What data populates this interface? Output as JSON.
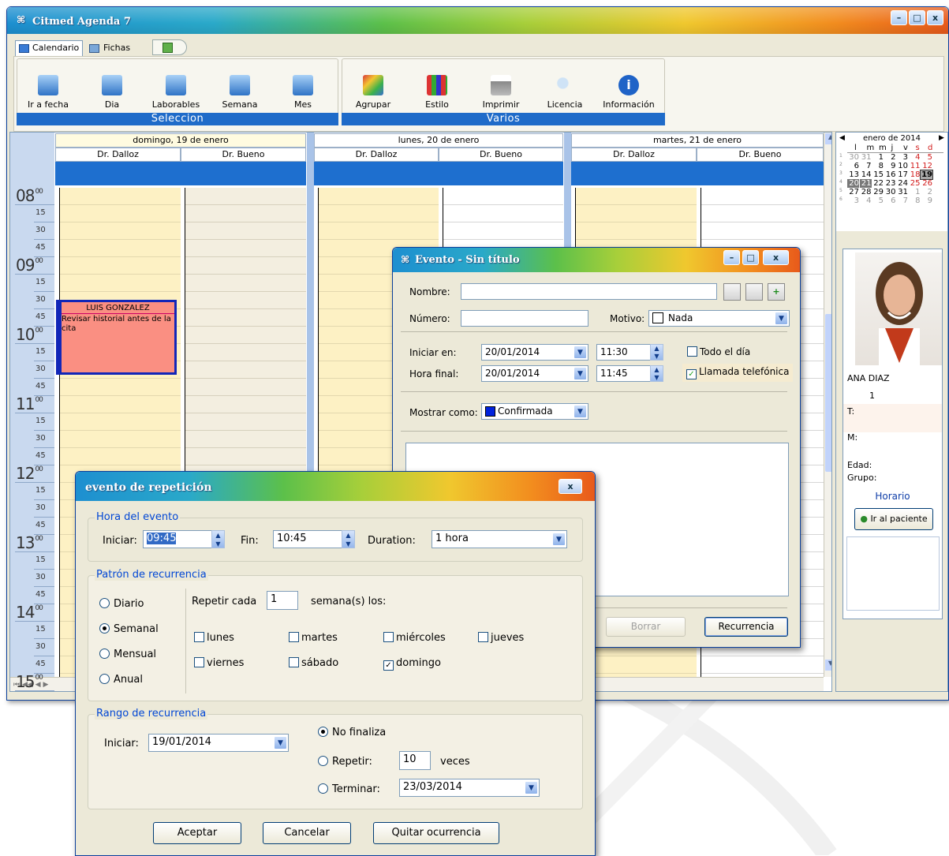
{
  "app": {
    "title": "Citmed Agenda 7"
  },
  "tabs": [
    {
      "label": "Calendario"
    },
    {
      "label": "Fichas"
    }
  ],
  "toolbar": {
    "seleccion": {
      "label": "Seleccion",
      "buttons": [
        "Ir a fecha",
        "Dia",
        "Laborables",
        "Semana",
        "Mes"
      ]
    },
    "varios": {
      "label": "Varios",
      "buttons": [
        "Agrupar",
        "Estilo",
        "Imprimir",
        "Licencia",
        "Información"
      ]
    }
  },
  "calendar": {
    "days": [
      "domingo, 19 de enero",
      "lunes, 20 de enero",
      "martes, 21 de enero"
    ],
    "doctors": [
      "Dr. Dalloz",
      "Dr. Bueno"
    ],
    "hours": [
      "08",
      "09",
      "10",
      "11",
      "12",
      "13",
      "14",
      "15"
    ],
    "minute_marks": [
      "00",
      "15",
      "30",
      "45"
    ],
    "event": {
      "title": "LUIS GONZALEZ",
      "text": "Revisar historial antes de la cita"
    }
  },
  "mini_calendar": {
    "month": "enero de 2014",
    "weekdays": [
      "l",
      "m",
      "m",
      "j",
      "v",
      "s",
      "d"
    ],
    "weeks": [
      {
        "wk": "1",
        "days": [
          "30",
          "31",
          "1",
          "2",
          "3",
          "4",
          "5"
        ]
      },
      {
        "wk": "2",
        "days": [
          "6",
          "7",
          "8",
          "9",
          "10",
          "11",
          "12"
        ]
      },
      {
        "wk": "3",
        "days": [
          "13",
          "14",
          "15",
          "16",
          "17",
          "18",
          "19"
        ]
      },
      {
        "wk": "4",
        "days": [
          "20",
          "21",
          "22",
          "23",
          "24",
          "25",
          "26"
        ]
      },
      {
        "wk": "5",
        "days": [
          "27",
          "28",
          "29",
          "30",
          "31",
          "1",
          "2"
        ]
      },
      {
        "wk": "6",
        "days": [
          "3",
          "4",
          "5",
          "6",
          "7",
          "8",
          "9"
        ]
      }
    ]
  },
  "patient": {
    "name": "ANA DIAZ",
    "id": "1",
    "t_label": "T:",
    "m_label": "M:",
    "edad_label": "Edad:",
    "grupo_label": "Grupo:",
    "horario_label": "Horario",
    "go_button": "Ir al paciente"
  },
  "evento": {
    "title": "Evento - Sin título",
    "nombre_label": "Nombre:",
    "numero_label": "Número:",
    "motivo_label": "Motivo:",
    "motivo_value": "Nada",
    "iniciar_label": "Iniciar en:",
    "iniciar_date": "20/01/2014",
    "iniciar_time": "11:30",
    "final_label": "Hora final:",
    "final_date": "20/01/2014",
    "final_time": "11:45",
    "todo_dia": "Todo el día",
    "llamada": "Llamada telefónica",
    "mostrar_label": "Mostrar como:",
    "mostrar_value": "Confirmada",
    "borrar": "Borrar",
    "recurrencia": "Recurrencia"
  },
  "repeticion": {
    "title": "evento de repetición",
    "hora_group": "Hora del evento",
    "iniciar_label": "Iniciar:",
    "iniciar_value": "09:45",
    "fin_label": "Fin:",
    "fin_value": "10:45",
    "duration_label": "Duration:",
    "duration_value": "1 hora",
    "patron_group": "Patrón de recurrencia",
    "options": [
      "Diario",
      "Semanal",
      "Mensual",
      "Anual"
    ],
    "repetir_label": "Repetir cada",
    "repetir_value": "1",
    "semanas_label": "semana(s) los:",
    "days": [
      "lunes",
      "martes",
      "miércoles",
      "jueves",
      "viernes",
      "sábado",
      "domingo"
    ],
    "rango_group": "Rango de recurrencia",
    "rango_iniciar_label": "Iniciar:",
    "rango_iniciar_value": "19/01/2014",
    "no_finaliza": "No finaliza",
    "repetir": "Repetir:",
    "repetir_count": "10",
    "veces": "veces",
    "terminar": "Terminar:",
    "terminar_value": "23/03/2014",
    "aceptar": "Aceptar",
    "cancelar": "Cancelar",
    "quitar": "Quitar ocurrencia"
  }
}
